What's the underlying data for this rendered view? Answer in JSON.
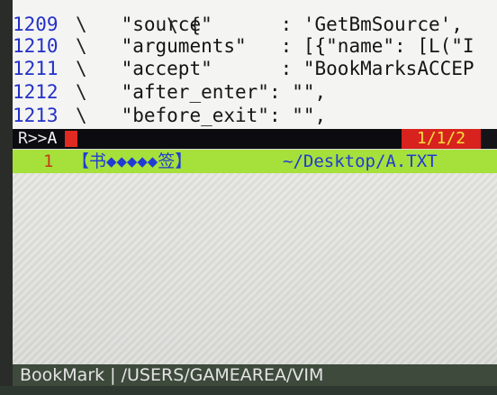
{
  "editor": {
    "code_lines": [
      {
        "line_number": "1209",
        "backslash": "\\",
        "text": "\"source\"      : 'GetBmSource',"
      },
      {
        "line_number": "1210",
        "backslash": "\\",
        "text": "\"arguments\"   : [{\"name\": [L(\"I"
      },
      {
        "line_number": "1211",
        "backslash": "\\",
        "text": "\"accept\"      : \"BookMarksACCEP"
      },
      {
        "line_number": "1212",
        "backslash": "\\",
        "text": "\"after_enter\": \"\","
      },
      {
        "line_number": "1213",
        "backslash": "\\",
        "text": "\"before_exit\": \"\","
      }
    ]
  },
  "tabline": {
    "mode": "R>>",
    "mode_letter": "A",
    "position": "1/1/2"
  },
  "bookmark_list": {
    "number": "1",
    "name": "【书◆◆◆◆◆签】",
    "path": "~/Desktop/A.TXT"
  },
  "statusline": {
    "text": "BookMark | /USERS/GAMEAREA/VIM"
  },
  "colors": {
    "line_number": "#2330c8",
    "tab_accent_red": "#d8221d",
    "tab_position_text": "#f6e23a",
    "list_highlight_green": "#a6e03a",
    "list_text_blue": "#1f3bd4",
    "list_number_red": "#c63b1a",
    "statusline_bg": "#3e4a3c"
  }
}
